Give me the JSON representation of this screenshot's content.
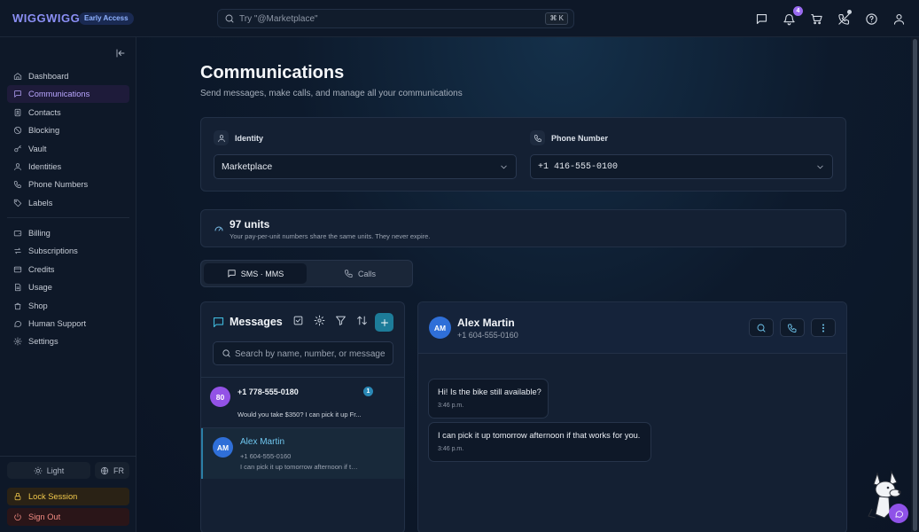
{
  "brand": {
    "logo": "WIGGWIGG",
    "badge": "Early Access"
  },
  "topbar": {
    "search_placeholder": "Try \"@Marketplace\"",
    "shortcut": "⌘ K",
    "notification_count": "4",
    "icons": [
      "message-square-icon",
      "bell-icon",
      "cart-icon",
      "phone-off-icon",
      "help-icon",
      "user-icon"
    ]
  },
  "sidebar": {
    "main_items": [
      {
        "label": "Dashboard",
        "icon": "home-icon",
        "active": false
      },
      {
        "label": "Communications",
        "icon": "message-square-icon",
        "active": true
      },
      {
        "label": "Contacts",
        "icon": "contacts-icon",
        "active": false
      },
      {
        "label": "Blocking",
        "icon": "ban-icon",
        "active": false
      },
      {
        "label": "Vault",
        "icon": "key-icon",
        "active": false
      },
      {
        "label": "Identities",
        "icon": "user-icon",
        "active": false
      },
      {
        "label": "Phone Numbers",
        "icon": "phone-icon",
        "active": false
      },
      {
        "label": "Labels",
        "icon": "tag-icon",
        "active": false
      }
    ],
    "account_items": [
      {
        "label": "Billing",
        "icon": "wallet-icon"
      },
      {
        "label": "Subscriptions",
        "icon": "repeat-icon"
      },
      {
        "label": "Credits",
        "icon": "credit-card-icon"
      },
      {
        "label": "Usage",
        "icon": "document-icon"
      },
      {
        "label": "Shop",
        "icon": "shopping-bag-icon"
      },
      {
        "label": "Human Support",
        "icon": "chat-bubble-icon"
      },
      {
        "label": "Settings",
        "icon": "gear-icon"
      }
    ],
    "theme_label": "Light",
    "language_label": "FR",
    "lock_label": "Lock Session",
    "signout_label": "Sign Out"
  },
  "page": {
    "title": "Communications",
    "subtitle": "Send messages, make calls, and manage all your communications"
  },
  "selectors": {
    "identity_label": "Identity",
    "identity_value": "Marketplace",
    "phone_label": "Phone Number",
    "phone_value": "+1 416-555-0100"
  },
  "units": {
    "title": "97 units",
    "subtitle": "Your pay-per-unit numbers share the same units. They never expire."
  },
  "tabs": [
    {
      "label": "SMS · MMS",
      "active": true
    },
    {
      "label": "Calls",
      "active": false
    }
  ],
  "messages": {
    "title": "Messages",
    "search_placeholder": "Search by name, number, or message",
    "conversations": [
      {
        "avatar": "80",
        "name": "+1 778-555-0180",
        "phone": "",
        "preview": "Would you take $350? I can pick it up Fr...",
        "unread": "1",
        "selected": false
      },
      {
        "avatar": "AM",
        "name": "Alex Martin",
        "phone": "+1 604-555-0160",
        "preview": "I can pick it up tomorrow afternoon if that works for you.",
        "unread": "",
        "selected": true
      }
    ]
  },
  "chat": {
    "avatar": "AM",
    "name": "Alex Martin",
    "phone": "+1 604-555-0160",
    "messages": [
      {
        "text": "Hi! Is the bike still available?",
        "time": "3:46 p.m."
      },
      {
        "text": "I can pick it up tomorrow afternoon if that works for you.",
        "time": "3:46 p.m."
      }
    ]
  },
  "colors": {
    "accent_purple": "#8b8ff5",
    "accent_teal": "#1d7c99",
    "active_nav": "#b9a6ff",
    "lock": "#f2c94c",
    "signout": "#f28b82"
  }
}
